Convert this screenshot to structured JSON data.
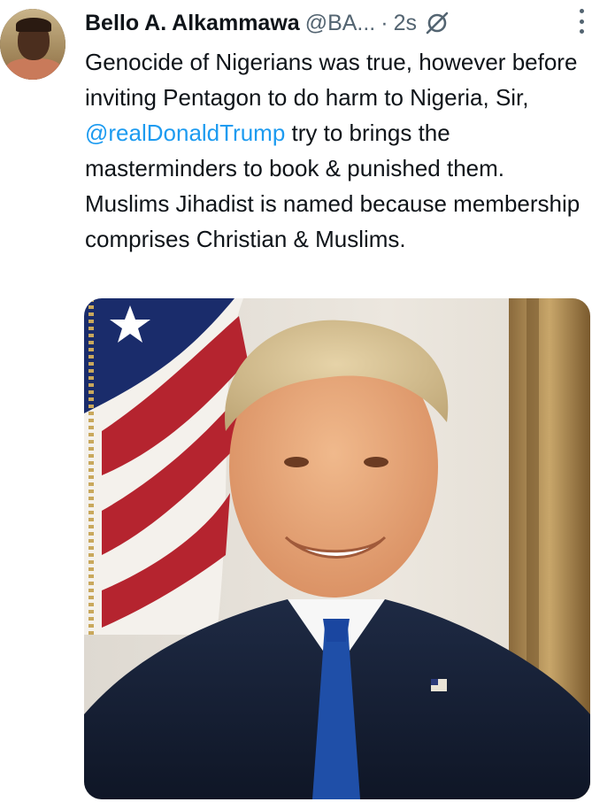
{
  "tweet": {
    "author_name": "Bello A. Alkammawa",
    "handle": "@BA...",
    "separator": "·",
    "time": "2s",
    "text_before": "Genocide of Nigerians was true, however before inviting Pentagon to do harm to Nigeria, Sir, ",
    "mention": "@realDonaldTrump",
    "text_after": " try to brings the masterminders to book & punished them. Muslims Jihadist is named because membership comprises Christian & Muslims."
  },
  "icons": {
    "grok": "grok-icon",
    "more": "more-vertical-icon"
  },
  "colors": {
    "text": "#0f1419",
    "secondary": "#536471",
    "link": "#1d9bf0"
  }
}
